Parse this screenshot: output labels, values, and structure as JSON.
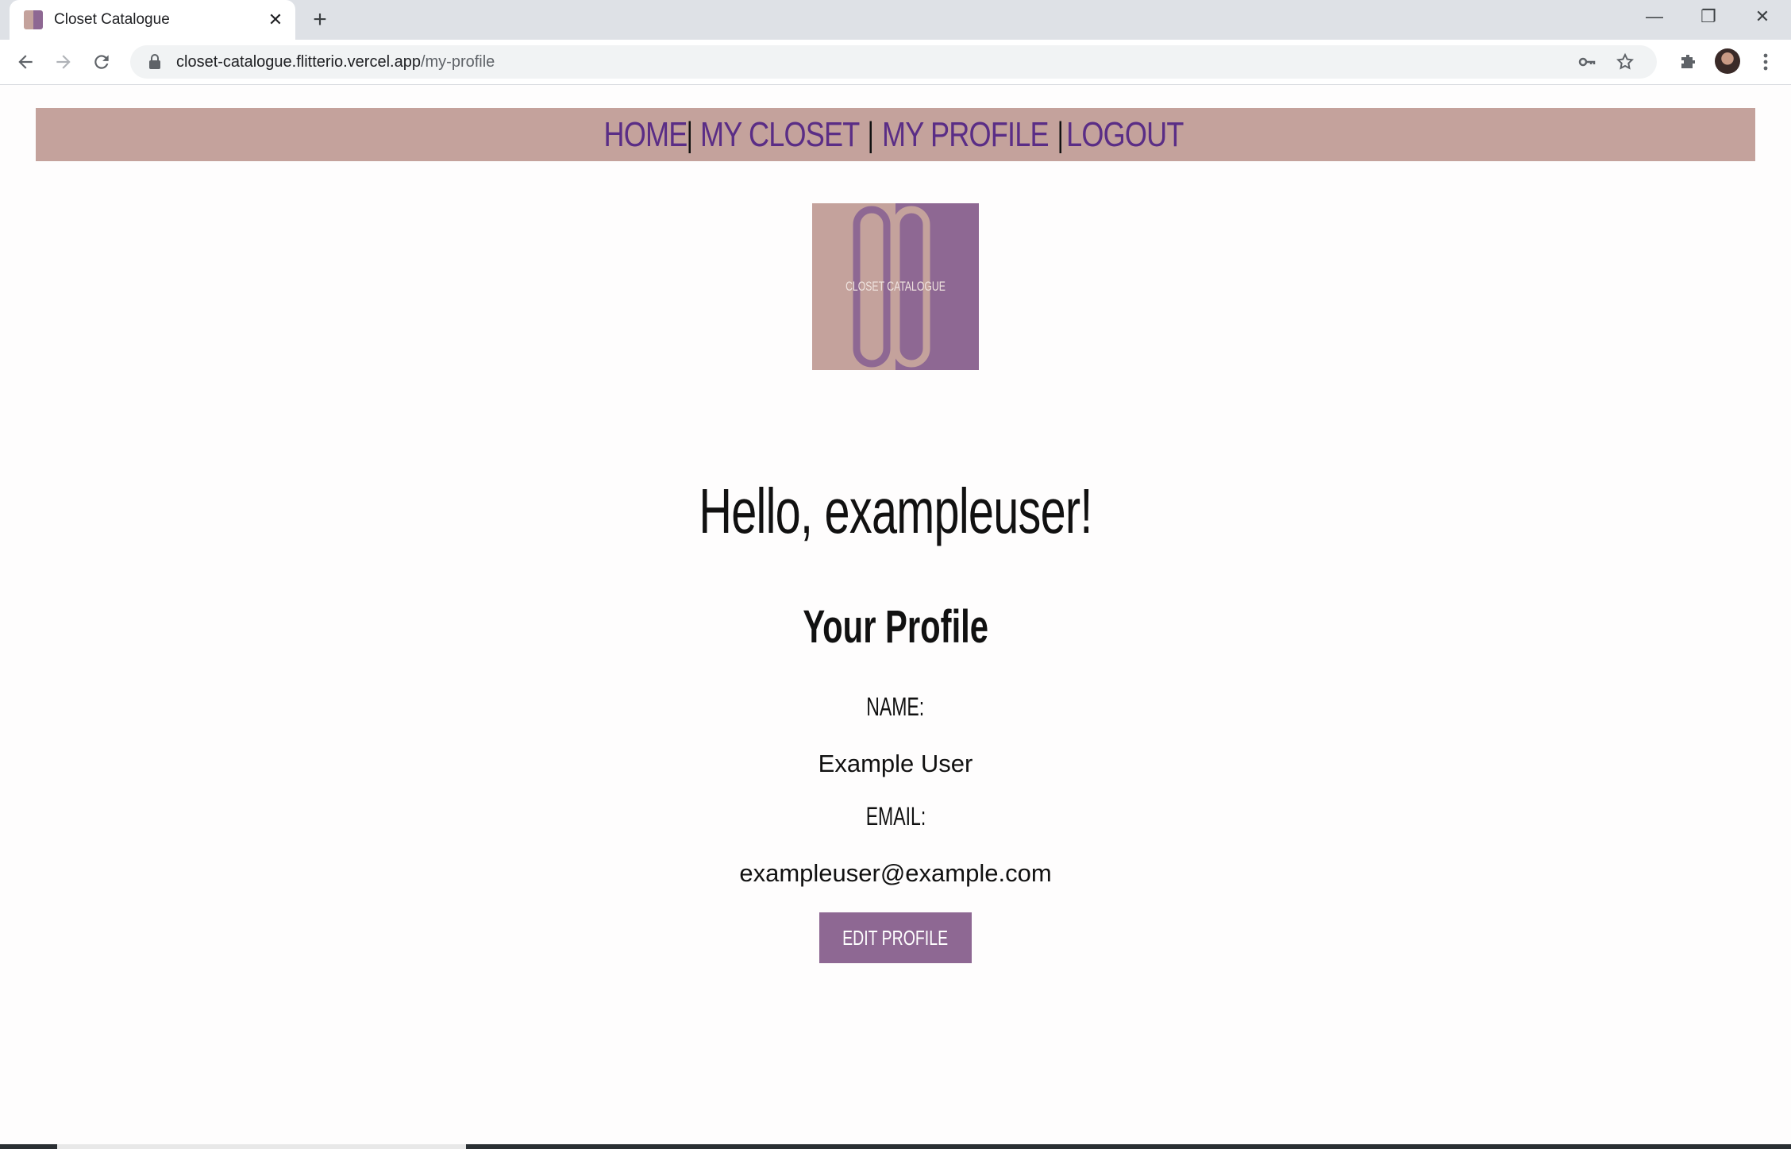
{
  "browser": {
    "tab_title": "Closet Catalogue",
    "close_glyph": "✕",
    "new_tab_glyph": "+",
    "url_domain": "closet-catalogue.flitterio.vercel.app",
    "url_path": "/my-profile",
    "minimize_glyph": "—",
    "restore_glyph": "❐",
    "window_close_glyph": "✕"
  },
  "nav": {
    "home": "HOME",
    "my_closet": "MY CLOSET",
    "my_profile": "MY PROFILE",
    "logout": "LOGOUT",
    "separator": "|"
  },
  "logo": {
    "text": "CLOSET CATALOGUE",
    "colors": {
      "left": "#c4a29c",
      "right": "#8e6893"
    }
  },
  "profile": {
    "greeting": "Hello, exampleuser!",
    "title": "Your Profile",
    "name_label": "NAME:",
    "name_value": "Example User",
    "email_label": "EMAIL:",
    "email_value": "exampleuser@example.com",
    "edit_button": "EDIT PROFILE"
  },
  "colors": {
    "navbar": "#c4a29c",
    "nav_link": "#5a2d86",
    "button": "#8e6893"
  }
}
